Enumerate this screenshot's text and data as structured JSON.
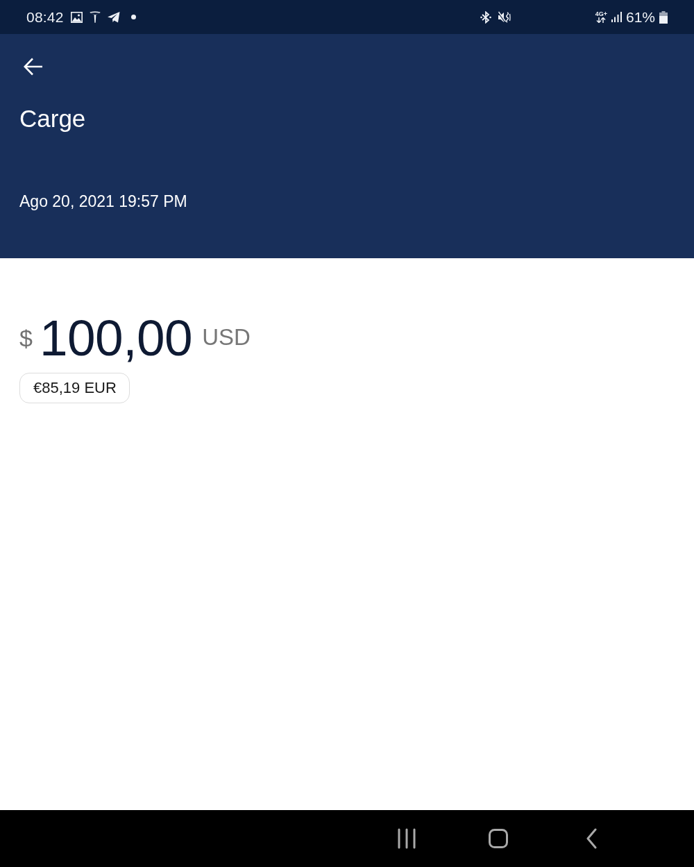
{
  "status_bar": {
    "time": "08:42",
    "network": "4G+",
    "battery": "61%"
  },
  "header": {
    "title": "Carge",
    "date": "Ago 20, 2021 19:57 PM"
  },
  "amount": {
    "symbol": "$",
    "value": "100,00",
    "currency": "USD",
    "converted": "€85,19 EUR"
  }
}
